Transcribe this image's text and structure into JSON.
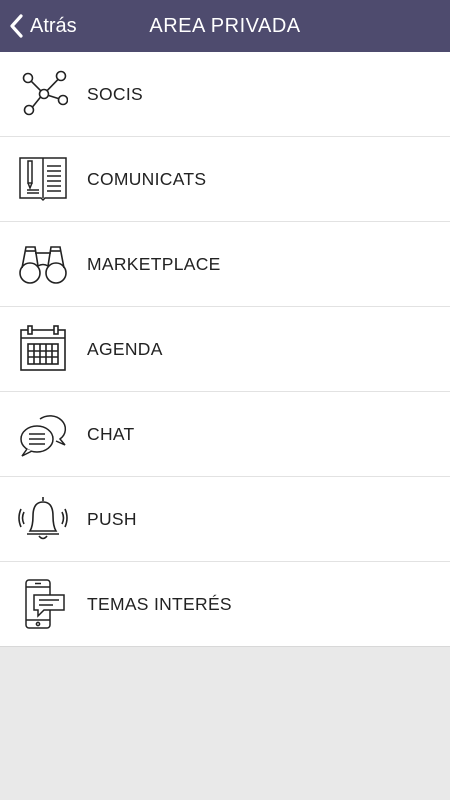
{
  "header": {
    "back_label": "Atrás",
    "title": "AREA PRIVADA",
    "background": "#4e4b6e"
  },
  "menu": {
    "items": [
      {
        "label": "SOCIS",
        "icon": "network-icon"
      },
      {
        "label": "COMUNICATS",
        "icon": "notebook-pen-icon"
      },
      {
        "label": "MARKETPLACE",
        "icon": "binoculars-icon"
      },
      {
        "label": "AGENDA",
        "icon": "calendar-icon"
      },
      {
        "label": "CHAT",
        "icon": "chat-bubbles-icon"
      },
      {
        "label": "PUSH",
        "icon": "bell-icon"
      },
      {
        "label": "TEMAS INTERÉS",
        "icon": "phone-message-icon"
      }
    ]
  }
}
